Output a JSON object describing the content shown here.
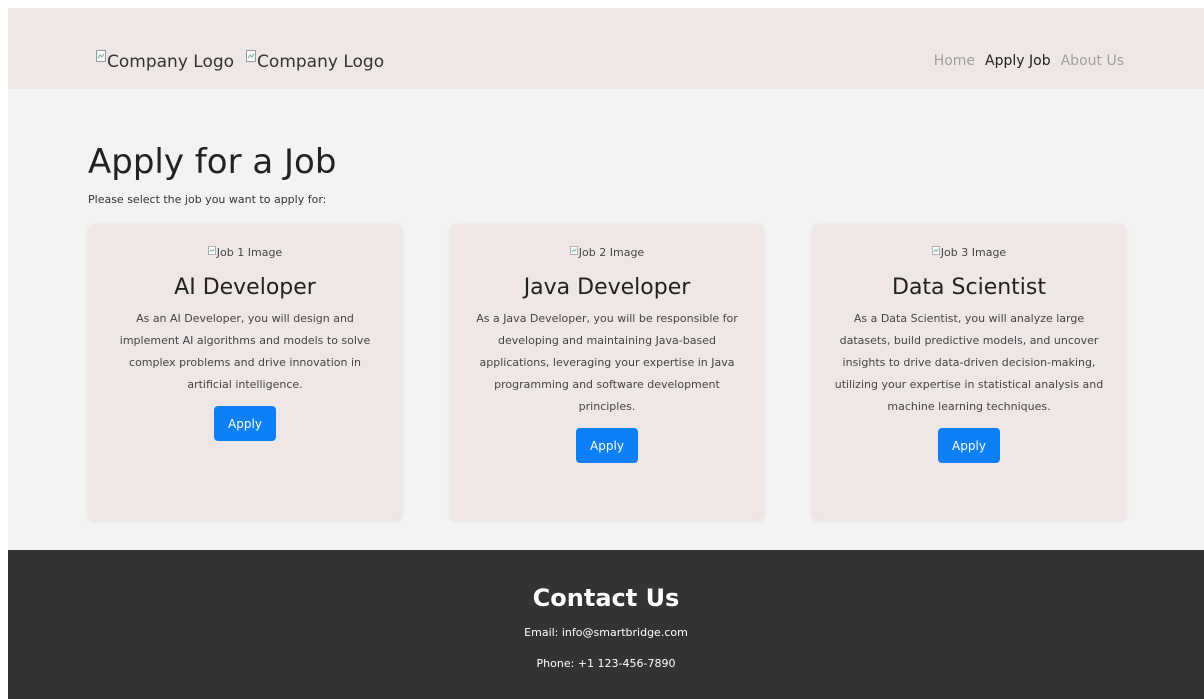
{
  "header": {
    "logos": [
      {
        "alt": "Company Logo",
        "icon": "broken-image-icon"
      },
      {
        "alt": "Company Logo",
        "icon": "broken-image-icon"
      }
    ],
    "nav": [
      {
        "label": "Home",
        "active": false
      },
      {
        "label": "Apply Job",
        "active": true
      },
      {
        "label": "About Us",
        "active": false
      }
    ]
  },
  "main": {
    "title": "Apply for a Job",
    "subtitle": "Please select the job you want to apply for:",
    "jobs": [
      {
        "image_alt": "Job 1 Image",
        "title": "AI Developer",
        "description": "As an AI Developer, you will design and implement AI algorithms and models to solve complex problems and drive innovation in artificial intelligence.",
        "button": "Apply"
      },
      {
        "image_alt": "Job 2 Image",
        "title": "Java Developer",
        "description": "As a Java Developer, you will be responsible for developing and maintaining Java-based applications, leveraging your expertise in Java programming and software development principles.",
        "button": "Apply"
      },
      {
        "image_alt": "Job 3 Image",
        "title": "Data Scientist",
        "description": "As a Data Scientist, you will analyze large datasets, build predictive models, and uncover insights to drive data-driven decision-making, utilizing your expertise in statistical analysis and machine learning techniques.",
        "button": "Apply"
      }
    ]
  },
  "footer": {
    "title": "Contact Us",
    "email": "Email: info@smartbridge.com",
    "phone": "Phone: +1 123-456-7890"
  },
  "colors": {
    "header_bg": "#efe6e6",
    "page_bg": "#f2f3f4",
    "card_bg": "#efe6e6",
    "button_bg": "#0d7ff7",
    "footer_bg": "#333333"
  }
}
